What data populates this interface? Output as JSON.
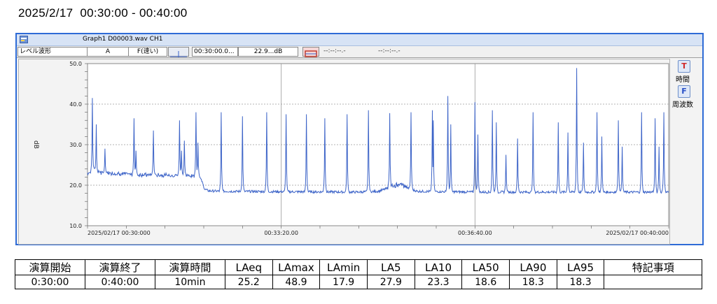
{
  "page": {
    "title": "2025/2/17  00:30:00 - 00:40:00"
  },
  "window": {
    "title": "Graph1 D00003.wav CH1",
    "icon": "app-icon"
  },
  "toolbar": {
    "mode": "レベル波形",
    "weighting": "A",
    "time_weighting": "F(速い)",
    "cursor_time": "00:30:00.0...",
    "cursor_value": "22.9...dB",
    "delta_time": "--:--:--.-",
    "delta_value": "--:--:--.-"
  },
  "side": {
    "time_button": "T",
    "time_label": "時間",
    "freq_button": "F",
    "freq_label": "周波数"
  },
  "chart_data": {
    "type": "line",
    "ylabel": "dB",
    "ylim": [
      10,
      50
    ],
    "yticks": [
      "10.0",
      "20.0",
      "30.0",
      "40.0",
      "50.0"
    ],
    "xlim": [
      0,
      600
    ],
    "xtick_positions": [
      0,
      200,
      400,
      600
    ],
    "xticks": [
      "2025/02/17 00:30:000",
      "00:33:20.00",
      "00:36:40.00",
      "2025/02/17 00:40:000"
    ],
    "grid": true,
    "color": "#3d64c8",
    "series": [
      {
        "baseline": [
          [
            0,
            23.0
          ],
          [
            5,
            23.3
          ],
          [
            15,
            22.9
          ],
          [
            22,
            23.0
          ],
          [
            35,
            22.8
          ],
          [
            50,
            22.6
          ],
          [
            75,
            22.5
          ],
          [
            100,
            22.4
          ],
          [
            115,
            22.3
          ],
          [
            118,
            21.0
          ],
          [
            121,
            19.0
          ],
          [
            125,
            18.6
          ],
          [
            140,
            18.5
          ],
          [
            200,
            18.4
          ],
          [
            280,
            18.3
          ],
          [
            300,
            18.5
          ],
          [
            315,
            19.6
          ],
          [
            322,
            20.4
          ],
          [
            330,
            19.4
          ],
          [
            340,
            18.5
          ],
          [
            400,
            18.3
          ],
          [
            500,
            18.3
          ],
          [
            600,
            18.3
          ]
        ],
        "spikes": [
          [
            5,
            41.5
          ],
          [
            9,
            35.0
          ],
          [
            18,
            29.0
          ],
          [
            48,
            36.5
          ],
          [
            50,
            28.5
          ],
          [
            68,
            33.5
          ],
          [
            95,
            36.0
          ],
          [
            97,
            28.5
          ],
          [
            100,
            31.0
          ],
          [
            112,
            38.0
          ],
          [
            114,
            30.5
          ],
          [
            138,
            38.0
          ],
          [
            160,
            37.0
          ],
          [
            185,
            38.0
          ],
          [
            205,
            37.5
          ],
          [
            226,
            37.5
          ],
          [
            245,
            36.5
          ],
          [
            268,
            37.5
          ],
          [
            290,
            38.5
          ],
          [
            312,
            37.5
          ],
          [
            334,
            38.0
          ],
          [
            356,
            38.5
          ],
          [
            357,
            36.0
          ],
          [
            372,
            42.0
          ],
          [
            375,
            35.0
          ],
          [
            400,
            40.5
          ],
          [
            403,
            32.5
          ],
          [
            418,
            38.5
          ],
          [
            422,
            35.5
          ],
          [
            432,
            27.5
          ],
          [
            444,
            31.5
          ],
          [
            460,
            38.0
          ],
          [
            486,
            35.5
          ],
          [
            496,
            33.0
          ],
          [
            505,
            48.9
          ],
          [
            512,
            30.5
          ],
          [
            526,
            38.0
          ],
          [
            531,
            32.0
          ],
          [
            548,
            36.0
          ],
          [
            552,
            29.5
          ],
          [
            572,
            38.0
          ],
          [
            586,
            36.5
          ],
          [
            590,
            29.5
          ],
          [
            595,
            38.0
          ]
        ]
      }
    ]
  },
  "stats": {
    "headers": [
      "演算開始",
      "演算終了",
      "演算時間",
      "LAeq",
      "LAmax",
      "LAmin",
      "LA5",
      "LA10",
      "LA50",
      "LA90",
      "LA95",
      "特記事項"
    ],
    "values": [
      "0:30:00",
      "0:40:00",
      "10min",
      "25.2",
      "48.9",
      "17.9",
      "27.9",
      "23.3",
      "18.6",
      "18.3",
      "18.3",
      ""
    ]
  }
}
